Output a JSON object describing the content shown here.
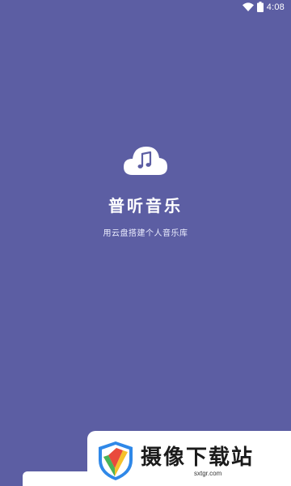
{
  "status_bar": {
    "time": "4:08",
    "icons": [
      "wifi-icon",
      "battery-icon"
    ]
  },
  "splash": {
    "logo_icon": "cloud-music-icon",
    "app_name": "普听音乐",
    "tagline": "用云盘搭建个人音乐库"
  },
  "watermark": {
    "title": "摄像下载站",
    "url": "sxtgr.com"
  },
  "colors": {
    "background": "#5c5ea3",
    "text": "#ffffff"
  }
}
